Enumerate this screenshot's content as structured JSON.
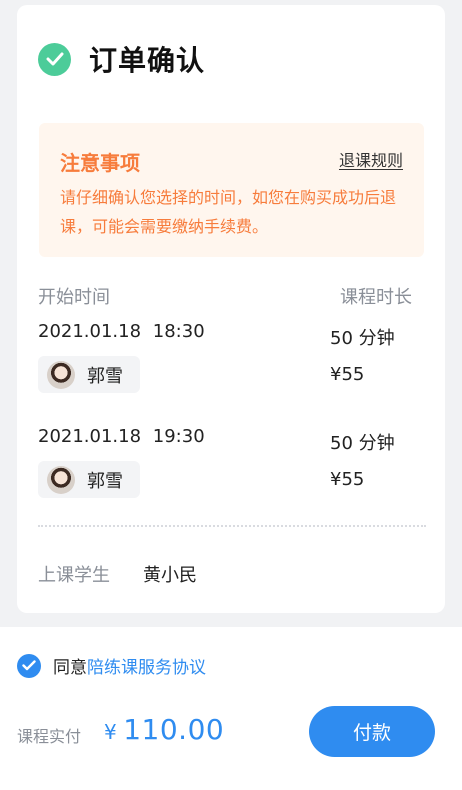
{
  "header": {
    "title": "订单确认",
    "icon": "check-circle-icon",
    "icon_color": "#4ccc99"
  },
  "notice": {
    "title": "注意事项",
    "link": "退课规则",
    "text": "请仔细确认您选择的时间，如您在购买成功后退课，可能会需要缴纳手续费。",
    "color": "#f77c3c"
  },
  "columns": {
    "start_time": "开始时间",
    "duration": "课程时长"
  },
  "lessons": [
    {
      "time": "2021.01.18 18:30",
      "teacher": "郭雪",
      "duration": "50 分钟",
      "price": "¥55"
    },
    {
      "time": "2021.01.18 19:30",
      "teacher": "郭雪",
      "duration": "50 分钟",
      "price": "¥55"
    }
  ],
  "student": {
    "label": "上课学生",
    "name": "黄小民"
  },
  "agreement": {
    "prefix": "同意",
    "link": "陪练课服务协议",
    "checked": true
  },
  "payment": {
    "label": "课程实付",
    "currency": "¥",
    "amount": "110.00",
    "button": "付款"
  },
  "colors": {
    "accent": "#2f8cf0",
    "muted": "#8a8f98"
  }
}
